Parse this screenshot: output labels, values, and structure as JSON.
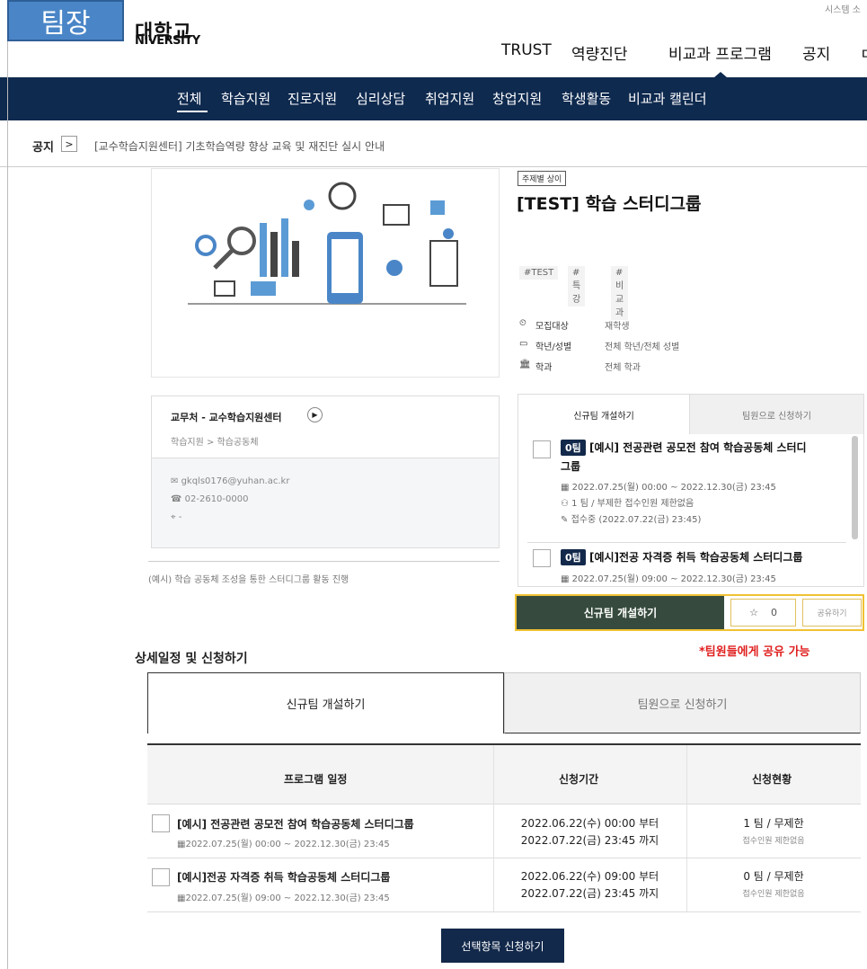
{
  "overlay_badge": "팀장",
  "header": {
    "logo_line1": "대학교",
    "logo_line2": "NIVERSITY",
    "system_link": "시스템 소",
    "gnb": [
      "TRUST",
      "역량진단",
      "비교과 프로그램",
      "공지",
      "ㄷ"
    ]
  },
  "nav": [
    "전체",
    "학습지원",
    "진로지원",
    "심리상담",
    "취업지원",
    "창업지원",
    "학생활동",
    "비교과 캘린더"
  ],
  "notice": {
    "label": "공지",
    "arrow": ">",
    "text": "[교수학습지원센터] 기초학습역량 향상 교육 및 재진단 실시 안내"
  },
  "program": {
    "category_tag": "주제별 상이",
    "title": "[TEST] 학습 스터디그룹",
    "hashtags": [
      "#TEST",
      "#특강",
      "#비교과"
    ],
    "info": [
      {
        "icon": "clock-icon",
        "label": "모집대상",
        "value": "재학생"
      },
      {
        "icon": "card-icon",
        "label": "학년/성별",
        "value": "전체 학년/전체 성별"
      },
      {
        "icon": "building-icon",
        "label": "학과",
        "value": "전체 학과"
      }
    ]
  },
  "org": {
    "name": "교무처 - 교수학습지원센터",
    "path": "학습지원 >  학습공동체",
    "email": "gkqls0176@yuhan.ac.kr",
    "phone": "02-2610-0000",
    "location": "-",
    "description": "(예시) 학습 공동체 조성을 통한 스터디그룹 활동 진행"
  },
  "panel": {
    "tabs": [
      "신규팀 개설하기",
      "팀원으로 신청하기"
    ],
    "items": [
      {
        "team_count": "0팀",
        "title": "[예시] 전공관련 공모전 참여 학습공동체 스터디",
        "title_cont": "그룹",
        "period": "2022.07.25(월) 00:00 ~ 2022.12.30(금) 23:45",
        "capacity": "1 팀 / 부제한 접수인원 제한없음",
        "status": "접수중 (2022.07.22(금) 23:45)"
      },
      {
        "team_count": "0팀",
        "title": "[예시]전공 자격증 취득 학습공동체 스터디그룹",
        "period": "2022.07.25(월) 09:00 ~ 2022.12.30(금) 23:45"
      }
    ],
    "cta": "신규팀 개설하기",
    "favorite_count": "0",
    "share": "공유하기",
    "share_note": "*팀원들에게 공유 가능"
  },
  "detail": {
    "title": "상세일정 및 신청하기",
    "tabs": [
      "신규팀 개설하기",
      "팀원으로 신청하기"
    ],
    "columns": [
      "프로그램 일정",
      "신청기간",
      "신청현황"
    ],
    "rows": [
      {
        "title": "[예시] 전공관련 공모전 참여 학습공동체 스터디그룹",
        "schedule": "2022.07.25(월) 00:00 ~ 2022.12.30(금) 23:45",
        "apply_start": "2022.06.22(수) 00:00 부터",
        "apply_end": "2022.07.22(금) 23:45 까지",
        "status": "1 팀 / 무제한",
        "status_sub": "접수인원 제한없음"
      },
      {
        "title": "[예시]전공 자격증 취득 학습공동체 스터디그룹",
        "schedule": "2022.07.25(월) 09:00 ~ 2022.12.30(금) 23:45",
        "apply_start": "2022.06.22(수) 09:00 부터",
        "apply_end": "2022.07.22(금) 23:45 까지",
        "status": "0 팀 / 무제한",
        "status_sub": "접수인원 제한없음"
      }
    ],
    "submit": "선택항목 신청하기"
  }
}
